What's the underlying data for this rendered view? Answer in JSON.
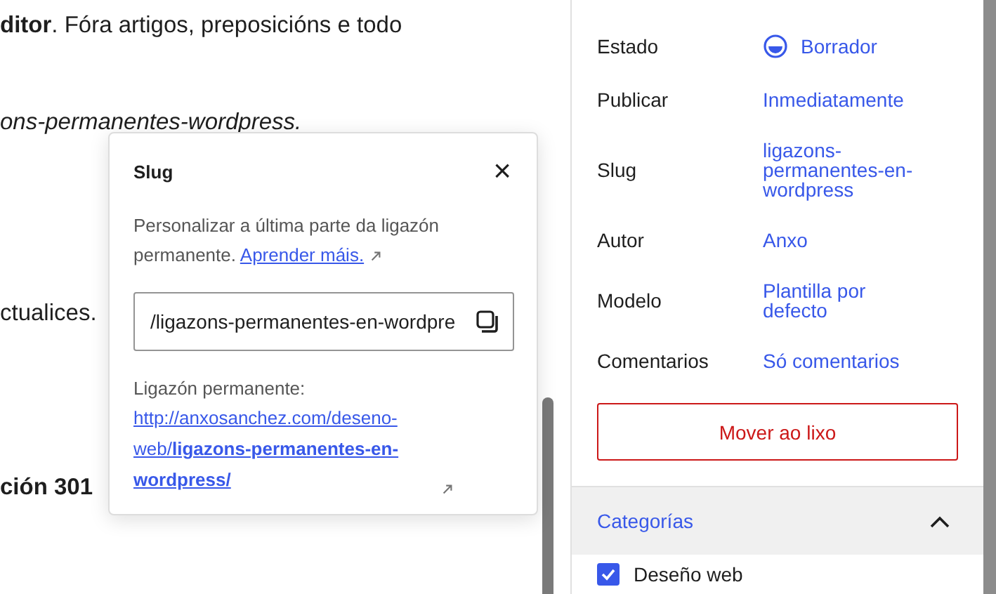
{
  "editor": {
    "paragraphs": [
      {
        "text": "**ditor**. Fóra artigos, preposicións e todo",
        "kind": "plain"
      },
      {
        "text": "ons-permanentes-wordpress.",
        "kind": "italic"
      },
      {
        "text": "ctualices.",
        "kind": "plain"
      },
      {
        "text": "**ción 301**",
        "kind": "plain"
      }
    ]
  },
  "slug_popover": {
    "title": "Slug",
    "close": "×",
    "description": "Personalizar a última parte da ligazón permanente.",
    "learn_more": "Aprender máis.",
    "slug_value": "/ligazons-permanentes-en-wordpre",
    "permalink_label": "Ligazón permanente:",
    "permalink": "http://anxosanchez.com/deseno-web/**ligazons-permanentes-en-wordpress/**"
  },
  "sidebar": {
    "fields": [
      {
        "label": "Estado",
        "value": "Borrador",
        "kind": "status"
      },
      {
        "label": "Publicar",
        "value": "Inmediatamente",
        "kind": "link"
      },
      {
        "label": "Slug",
        "value": "ligazons-permanentes-en-wordpress",
        "kind": "link"
      },
      {
        "label": "Autor",
        "value": "Anxo",
        "kind": "link"
      },
      {
        "label": "Modelo",
        "value": "Plantilla por defecto",
        "kind": "link"
      },
      {
        "label": "Comentarios",
        "value": "Só comentarios",
        "kind": "link"
      }
    ],
    "trash_button": "Mover ao lixo",
    "categories": {
      "title": "Categorías",
      "expanded": true,
      "items": [
        {
          "label": "Deseño web",
          "checked": true
        }
      ]
    }
  }
}
